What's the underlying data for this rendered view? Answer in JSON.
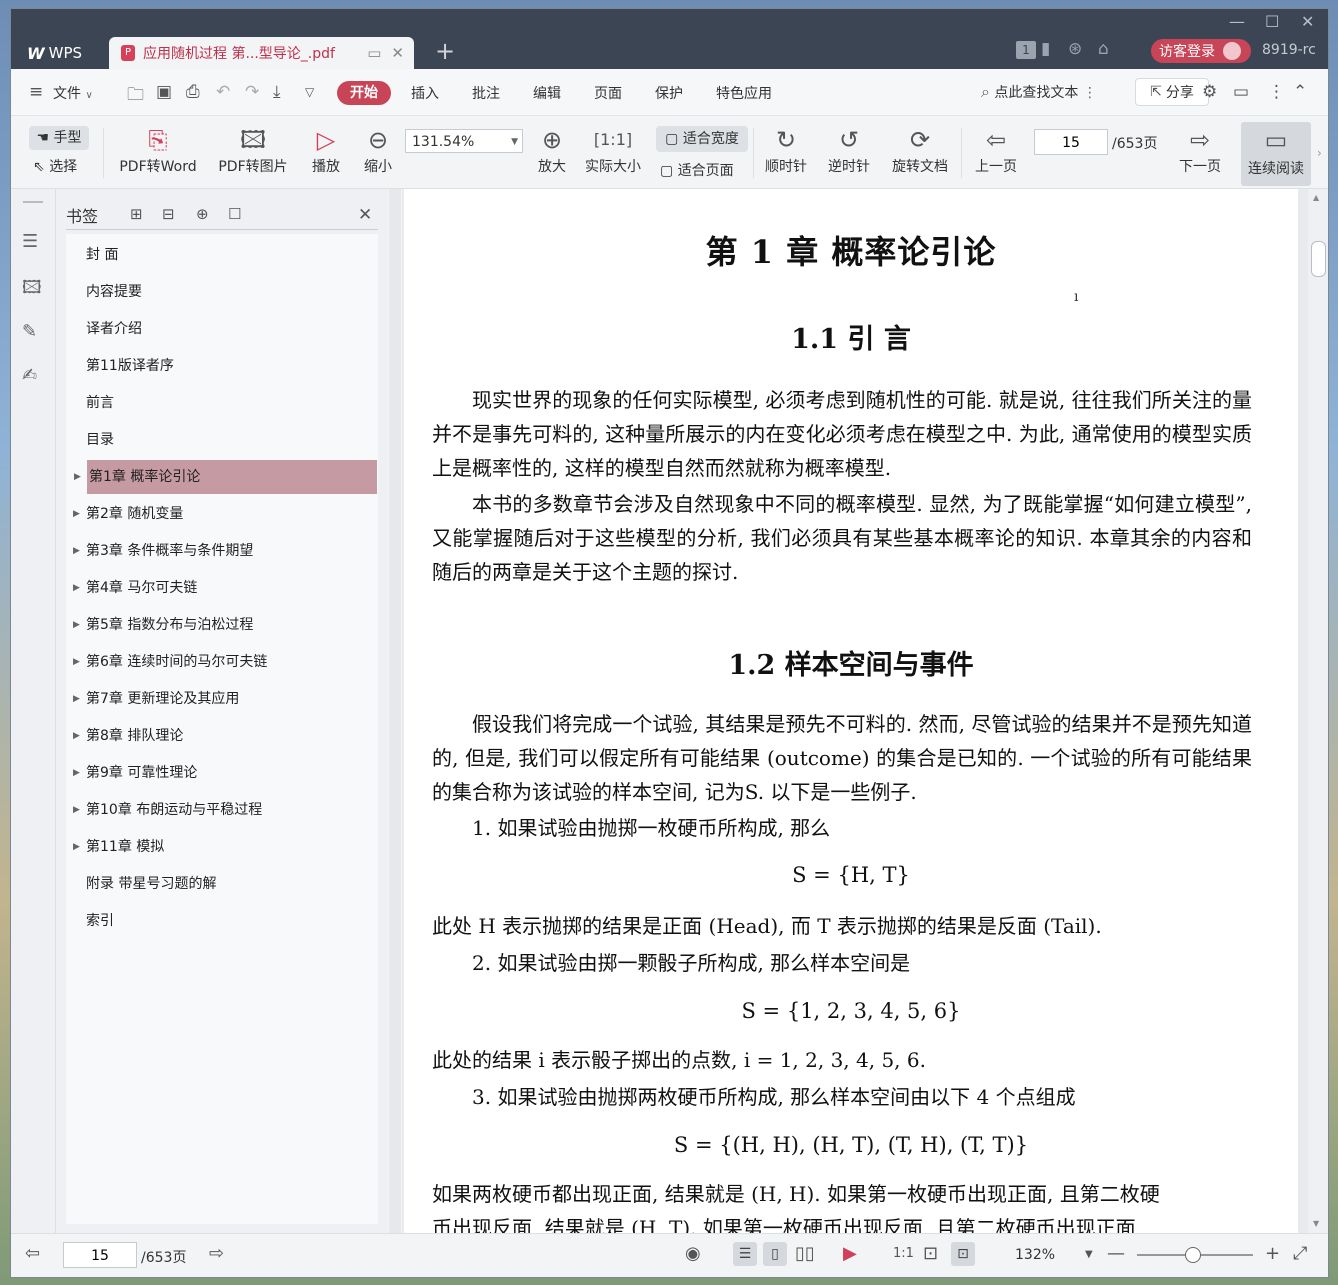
{
  "app": {
    "name": "WPS",
    "tab_title": "应用随机过程 第...型导论_.pdf",
    "new_tab": "+",
    "tab_count": "1",
    "login_label": "访客登录",
    "user": "8919-rc"
  },
  "menu": {
    "file": "文件",
    "items": [
      "开始",
      "插入",
      "批注",
      "编辑",
      "页面",
      "保护",
      "特色应用"
    ],
    "search": "点此查找文本",
    "share": "分享"
  },
  "toolbar": {
    "hand": "手型",
    "select": "选择",
    "pdf_to_word": "PDF转Word",
    "pdf_to_image": "PDF转图片",
    "play": "播放",
    "zoom_out": "缩小",
    "zoom_value": "131.54%",
    "zoom_in": "放大",
    "actual_size": "实际大小",
    "fit_width": "适合宽度",
    "fit_page": "适合页面",
    "rotate_cw": "顺时针",
    "rotate_ccw": "逆时针",
    "rotate_doc": "旋转文档",
    "prev_page": "上一页",
    "page_current": "15",
    "page_total": "/653页",
    "next_page": "下一页",
    "continuous": "连续阅读"
  },
  "bookmarks": {
    "title": "书签",
    "items": [
      {
        "label": "封  面",
        "expandable": false
      },
      {
        "label": "内容提要",
        "expandable": false
      },
      {
        "label": "译者介绍",
        "expandable": false
      },
      {
        "label": "第11版译者序",
        "expandable": false
      },
      {
        "label": "前言",
        "expandable": false
      },
      {
        "label": "目录",
        "expandable": false
      },
      {
        "label": "第1章  概率论引论",
        "expandable": true
      },
      {
        "label": "第2章  随机变量",
        "expandable": true
      },
      {
        "label": "第3章  条件概率与条件期望",
        "expandable": true
      },
      {
        "label": "第4章  马尔可夫链",
        "expandable": true
      },
      {
        "label": "第5章  指数分布与泊松过程",
        "expandable": true
      },
      {
        "label": "第6章  连续时间的马尔可夫链",
        "expandable": true
      },
      {
        "label": "第7章  更新理论及其应用",
        "expandable": true
      },
      {
        "label": "第8章  排队理论",
        "expandable": true
      },
      {
        "label": "第9章  可靠性理论",
        "expandable": true
      },
      {
        "label": "第10章  布朗运动与平稳过程",
        "expandable": true
      },
      {
        "label": "第11章  模拟",
        "expandable": true
      },
      {
        "label": "附录  带星号习题的解",
        "expandable": false
      },
      {
        "label": "索引",
        "expandable": false
      }
    ],
    "active_index": 6
  },
  "document": {
    "chapter_title": "第 1 章    概率论引论",
    "sec1_title": "1.1    引        言",
    "sec1_p1": "现实世界的现象的任何实际模型, 必须考虑到随机性的可能. 就是说, 往往我们所关注的量并不是事先可料的, 这种量所展示的内在变化必须考虑在模型之中. 为此, 通常使用的模型实质上是概率性的, 这样的模型自然而然就称为概率模型.",
    "sec1_p2": "本书的多数章节会涉及自然现象中不同的概率模型. 显然, 为了既能掌握“如何建立模型”, 又能掌握随后对于这些模型的分析, 我们必须具有某些基本概率论的知识. 本章其余的内容和随后的两章是关于这个主题的探讨.",
    "sec2_title": "1.2      样本空间与事件",
    "sec2_p1": "假设我们将完成一个试验, 其结果是预先不可料的. 然而, 尽管试验的结果并不是预先知道的, 但是, 我们可以假定所有可能结果 (outcome) 的集合是已知的. 一个试验的所有可能结果的集合称为该试验的样本空间, 记为S. 以下是一些例子.",
    "item1": "1. 如果试验由抛掷一枚硬币所构成, 那么",
    "eq1": "S = {H, T}",
    "after1": "此处 H 表示抛掷的结果是正面 (Head), 而 T 表示抛掷的结果是反面 (Tail).",
    "item2": "2. 如果试验由掷一颗骰子所构成, 那么样本空间是",
    "eq2": "S = {1, 2, 3, 4, 5, 6}",
    "after2": "此处的结果 i 表示骰子掷出的点数, i = 1, 2, 3, 4, 5, 6.",
    "item3": "3. 如果试验由抛掷两枚硬币所构成, 那么样本空间由以下 4 个点组成",
    "eq3": "S = {(H, H), (H, T), (T, H), (T, T)}",
    "after3a": "如果两枚硬币都出现正面, 结果就是 (H, H). 如果第一枚硬币出现正面, 且第二枚硬",
    "after3b": "币出现反面, 结果就是 (H, T). 如果第一枚硬币出现反面, 且第二枚硬币出现正面"
  },
  "status": {
    "page_current": "15",
    "page_total": "/653页",
    "zoom": "132%"
  },
  "colors": {
    "accent": "#c84558",
    "titlebar": "#3c4553",
    "bookmark_active": "#c69aa3"
  }
}
